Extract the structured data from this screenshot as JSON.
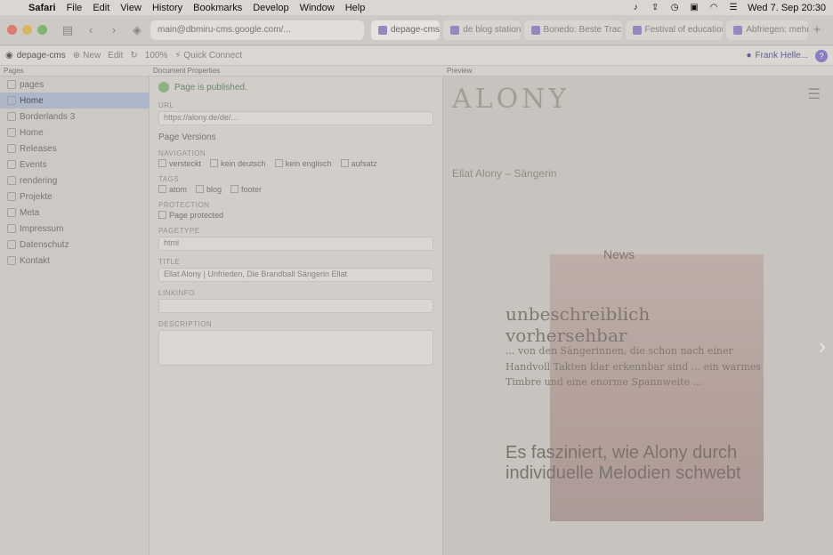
{
  "menubar": {
    "apple": "",
    "items": [
      "Safari",
      "File",
      "Edit",
      "View",
      "History",
      "Bookmarks",
      "Develop",
      "Window",
      "Help"
    ],
    "clock": "Wed 7. Sep  20:30"
  },
  "browser": {
    "address": "main@dbmiru-cms.google.com/...",
    "tabs": [
      {
        "label": "depage-cms",
        "active": true
      },
      {
        "label": "de blog station"
      },
      {
        "label": "Bonedo: Beste Tracks"
      },
      {
        "label": "Festival of education"
      },
      {
        "label": "Abfriegen: mehr"
      }
    ],
    "new_tab": "+"
  },
  "toolbar": {
    "brand": "depage-cms",
    "new_label": "New",
    "edit_label": "Edit",
    "zoom": "100%",
    "quick_connect": "Quick Connect",
    "user": "Frank Helle...",
    "help": "?"
  },
  "panels": {
    "pages_head": "Pages",
    "props_head": "Document Properties",
    "preview_head": "Preview"
  },
  "pages": {
    "items": [
      {
        "label": "pages",
        "selected": false
      },
      {
        "label": "Home",
        "selected": true
      },
      {
        "label": "Borderlands 3",
        "selected": false
      },
      {
        "label": "Home",
        "selected": false
      },
      {
        "label": "Releases",
        "selected": false
      },
      {
        "label": "Events",
        "selected": false
      },
      {
        "label": "rendering",
        "selected": false
      },
      {
        "label": "Projekte",
        "selected": false
      },
      {
        "label": "Meta",
        "selected": false
      },
      {
        "label": "Impressum",
        "selected": false
      },
      {
        "label": "Datenschutz",
        "selected": false
      },
      {
        "label": "Kontakt",
        "selected": false
      }
    ]
  },
  "properties": {
    "status": "Page is published.",
    "url_label": "URL",
    "url_value": "https://alony.de/de/...",
    "versions_label": "Page Versions",
    "navigation_label": "NAVIGATION",
    "navigation_checks": [
      "versteckt",
      "kein deutsch",
      "kein englisch",
      "aufsatz"
    ],
    "tags_label": "TAGS",
    "tags_checks": [
      "atom",
      "blog",
      "footer"
    ],
    "protection_label": "PROTECTION",
    "protection_value": "Page protected",
    "pagetype_label": "PAGETYPE",
    "pagetype_value": "html",
    "title_label": "TITLE",
    "title_value": "Ellat Alony | Unfrieden, Die Brandball Sängerin Ellat",
    "linkinfo_label": "LINKINFO",
    "description_label": "DESCRIPTION"
  },
  "preview": {
    "logo": "ALONY",
    "hero_text": "Ellat Alony – Sängerin",
    "news": "News",
    "caption": "unbeschreiblich vorhersehbar",
    "body": "... von den Sängerinnen, die schon nach einer Handvoll Takten klar erkennbar sind ... ein warmes Timbre und eine enorme Spannweite ...",
    "big_text": "Es fasziniert, wie Alony durch individuelle Melodien schwebt",
    "arrow": "›"
  }
}
